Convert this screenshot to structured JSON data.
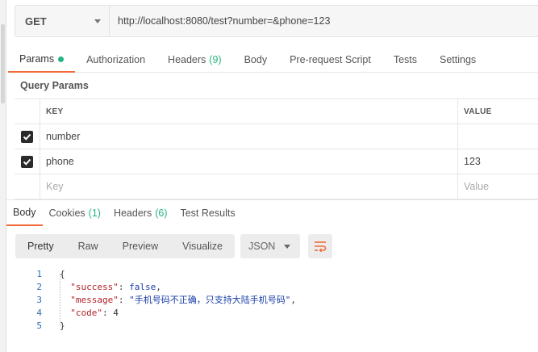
{
  "request": {
    "method": "GET",
    "url": "http://localhost:8080/test?number=&phone=123"
  },
  "request_tabs": [
    {
      "label": "Params",
      "active": true
    },
    {
      "label": "Authorization"
    },
    {
      "label": "Headers",
      "count": "(9)"
    },
    {
      "label": "Body"
    },
    {
      "label": "Pre-request Script"
    },
    {
      "label": "Tests"
    },
    {
      "label": "Settings"
    }
  ],
  "query_params": {
    "title": "Query Params",
    "headers": {
      "key": "KEY",
      "value": "VALUE"
    },
    "rows": [
      {
        "key": "number",
        "value": "",
        "checked": true
      },
      {
        "key": "phone",
        "value": "123",
        "checked": true
      }
    ],
    "placeholder": {
      "key": "Key",
      "value": "Value"
    }
  },
  "response_tabs": [
    {
      "label": "Body",
      "active": true
    },
    {
      "label": "Cookies",
      "count": "(1)"
    },
    {
      "label": "Headers",
      "count": "(6)"
    },
    {
      "label": "Test Results"
    }
  ],
  "view_modes": [
    "Pretty",
    "Raw",
    "Preview",
    "Visualize"
  ],
  "format": "JSON",
  "response_body": {
    "line_numbers": [
      "1",
      "2",
      "3",
      "4",
      "5"
    ],
    "open_brace": "{",
    "close_brace": "}",
    "success_key": "\"success\"",
    "success_val": "false",
    "message_key": "\"message\"",
    "message_val": "\"手机号码不正确，只支持大陆手机号码\"",
    "code_key": "\"code\"",
    "code_val": "4"
  },
  "colors": {
    "accent": "#f26b3a",
    "green": "#26b47f"
  }
}
